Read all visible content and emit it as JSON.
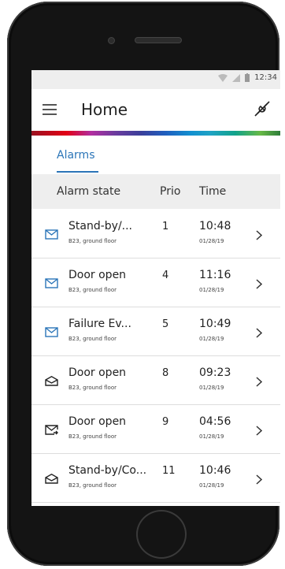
{
  "status_bar": {
    "time": "12:34",
    "icons": [
      "wifi-icon",
      "signal-icon",
      "battery-icon"
    ]
  },
  "app_bar": {
    "title": "Home",
    "menu_icon": "hamburger-menu-icon",
    "action_icon": "disconnected-plug-icon"
  },
  "tabs": [
    {
      "label": "Alarms",
      "active": true
    }
  ],
  "table": {
    "headers": {
      "state": "Alarm state",
      "prio": "Prio",
      "time": "Time"
    },
    "rows": [
      {
        "name": "Stand-by/...",
        "location": "B23, ground floor",
        "prio": "1",
        "time": "10:48",
        "date": "01/28/19",
        "icon": "envelope-closed-icon",
        "icon_color": "#2b75b8"
      },
      {
        "name": "Door open",
        "location": "B23, ground floor",
        "prio": "4",
        "time": "11:16",
        "date": "01/28/19",
        "icon": "envelope-closed-icon",
        "icon_color": "#2b75b8"
      },
      {
        "name": "Failure Ev...",
        "location": "B23, ground floor",
        "prio": "5",
        "time": "10:49",
        "date": "01/28/19",
        "icon": "envelope-closed-icon",
        "icon_color": "#2b75b8"
      },
      {
        "name": "Door open",
        "location": "B23, ground floor",
        "prio": "8",
        "time": "09:23",
        "date": "01/28/19",
        "icon": "envelope-open-icon",
        "icon_color": "#222222"
      },
      {
        "name": "Door open",
        "location": "B23, ground floor",
        "prio": "9",
        "time": "04:56",
        "date": "01/28/19",
        "icon": "envelope-forward-icon",
        "icon_color": "#222222"
      },
      {
        "name": "Stand-by/Co...",
        "location": "B23, ground floor",
        "prio": "11",
        "time": "10:46",
        "date": "01/28/19",
        "icon": "envelope-open-icon",
        "icon_color": "#222222"
      }
    ]
  },
  "colors": {
    "accent": "#2b75b8",
    "header_bg": "#eeeeee"
  }
}
